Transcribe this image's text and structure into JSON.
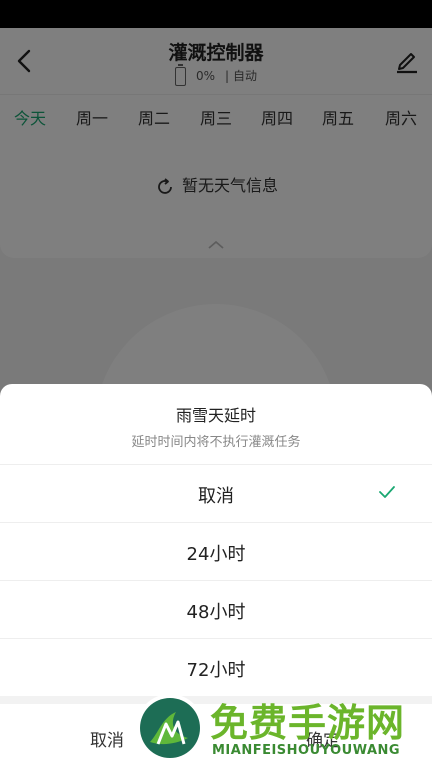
{
  "header": {
    "title": "灌溉控制器",
    "battery_percent": "0%",
    "separator": "|",
    "mode": "自动"
  },
  "days": [
    "今天",
    "周一",
    "周二",
    "周三",
    "周四",
    "周五",
    "周六"
  ],
  "weather": {
    "text": "暂无天气信息"
  },
  "sheet": {
    "title": "雨雪天延时",
    "subtitle": "延时时间内将不执行灌溉任务",
    "options": [
      {
        "label": "取消",
        "selected": true
      },
      {
        "label": "24小时",
        "selected": false
      },
      {
        "label": "48小时",
        "selected": false
      },
      {
        "label": "72小时",
        "selected": false
      }
    ],
    "cancel_label": "取消",
    "confirm_label": "确定"
  },
  "watermark": {
    "title": "免费手游网",
    "subtitle": "MIANFEISHOUYOUWANG"
  },
  "colors": {
    "accent": "#1aa872",
    "watermark_green": "#6bb52b"
  }
}
